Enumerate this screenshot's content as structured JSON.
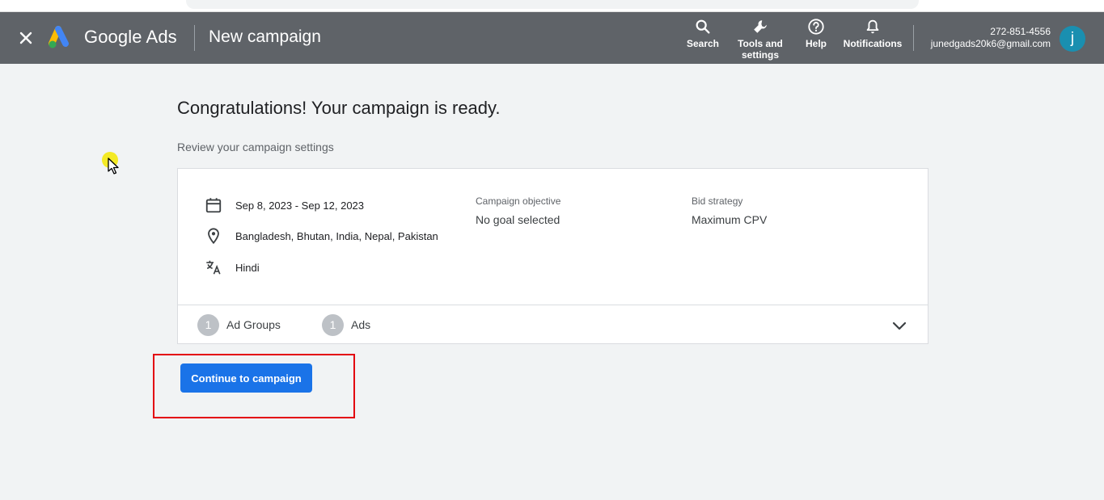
{
  "header": {
    "brand": "Google Ads",
    "page_title": "New campaign",
    "tools": [
      {
        "label": "Search",
        "icon": "search-icon"
      },
      {
        "label": "Tools and\nsettings",
        "icon": "wrench-icon"
      },
      {
        "label": "Help",
        "icon": "help-icon"
      },
      {
        "label": "Notifications",
        "icon": "bell-icon"
      }
    ],
    "account": {
      "phone": "272-851-4556",
      "email": "junedgads20k6@gmail.com",
      "avatar_letter": "j"
    }
  },
  "main": {
    "headline": "Congratulations! Your campaign is ready.",
    "subhead": "Review your campaign settings",
    "summary": {
      "dates": "Sep 8, 2023 - Sep 12, 2023",
      "locations": "Bangladesh, Bhutan, India, Nepal, Pakistan",
      "language": "Hindi",
      "objective_label": "Campaign objective",
      "objective_value": "No goal selected",
      "bid_label": "Bid strategy",
      "bid_value": "Maximum CPV"
    },
    "footer": {
      "ad_groups_count": "1",
      "ad_groups_label": "Ad Groups",
      "ads_count": "1",
      "ads_label": "Ads"
    },
    "cta_label": "Continue to campaign"
  },
  "colors": {
    "header_bg": "#5f6368",
    "primary": "#1a73e8",
    "highlight": "#e3000f",
    "avatar": "#1a8fb0"
  }
}
